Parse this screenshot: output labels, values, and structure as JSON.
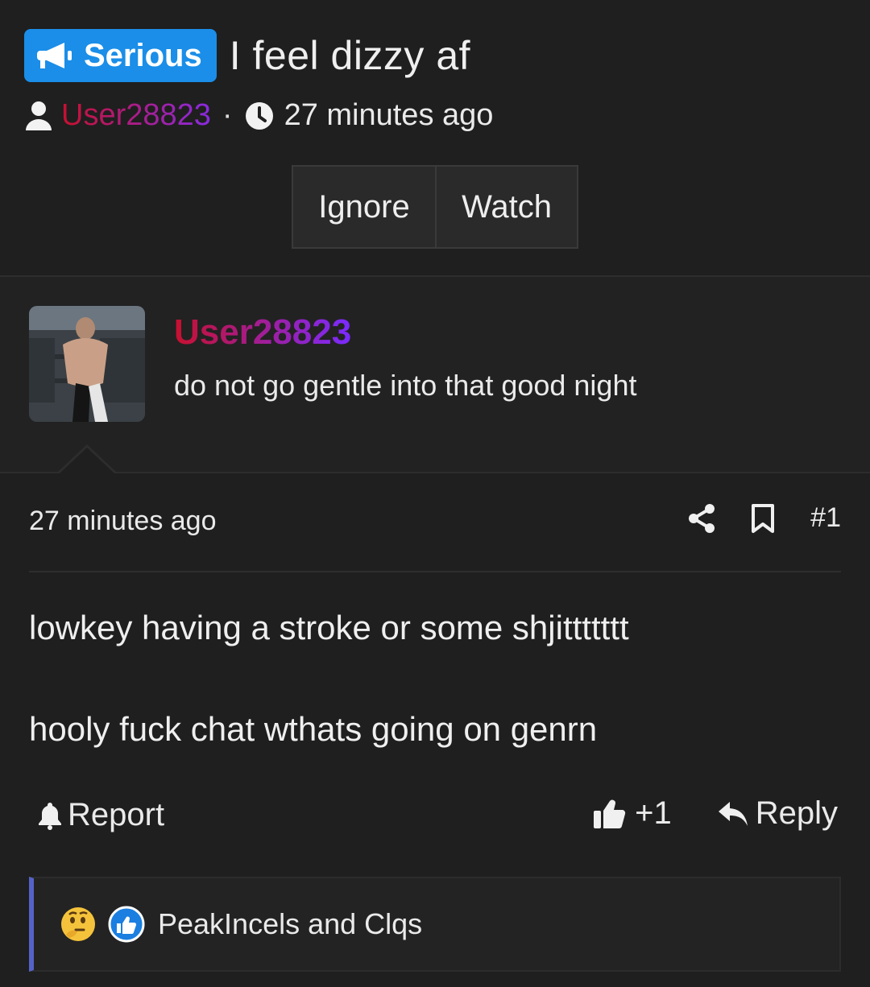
{
  "thread": {
    "prefix": "Serious",
    "title": "I feel dizzy af",
    "author": "User28823",
    "time": "27 minutes ago"
  },
  "thread_actions": {
    "ignore": "Ignore",
    "watch": "Watch"
  },
  "post": {
    "author": "User28823",
    "user_title": "do not go gentle into that good night",
    "time": "27 minutes ago",
    "number": "#1",
    "lines": [
      "lowkey having a stroke or some shjittttttt",
      "hooly fuck chat wthats going on genrn"
    ],
    "report_label": "Report",
    "like_count": "+1",
    "reply_label": "Reply"
  },
  "reactions": {
    "summary": "PeakIncels and Clqs"
  },
  "colors": {
    "prefix_bg": "#1a8ee8",
    "name_start": "#c8102e",
    "name_end": "#7a2bff",
    "reaction_bar": "#5563c8"
  }
}
